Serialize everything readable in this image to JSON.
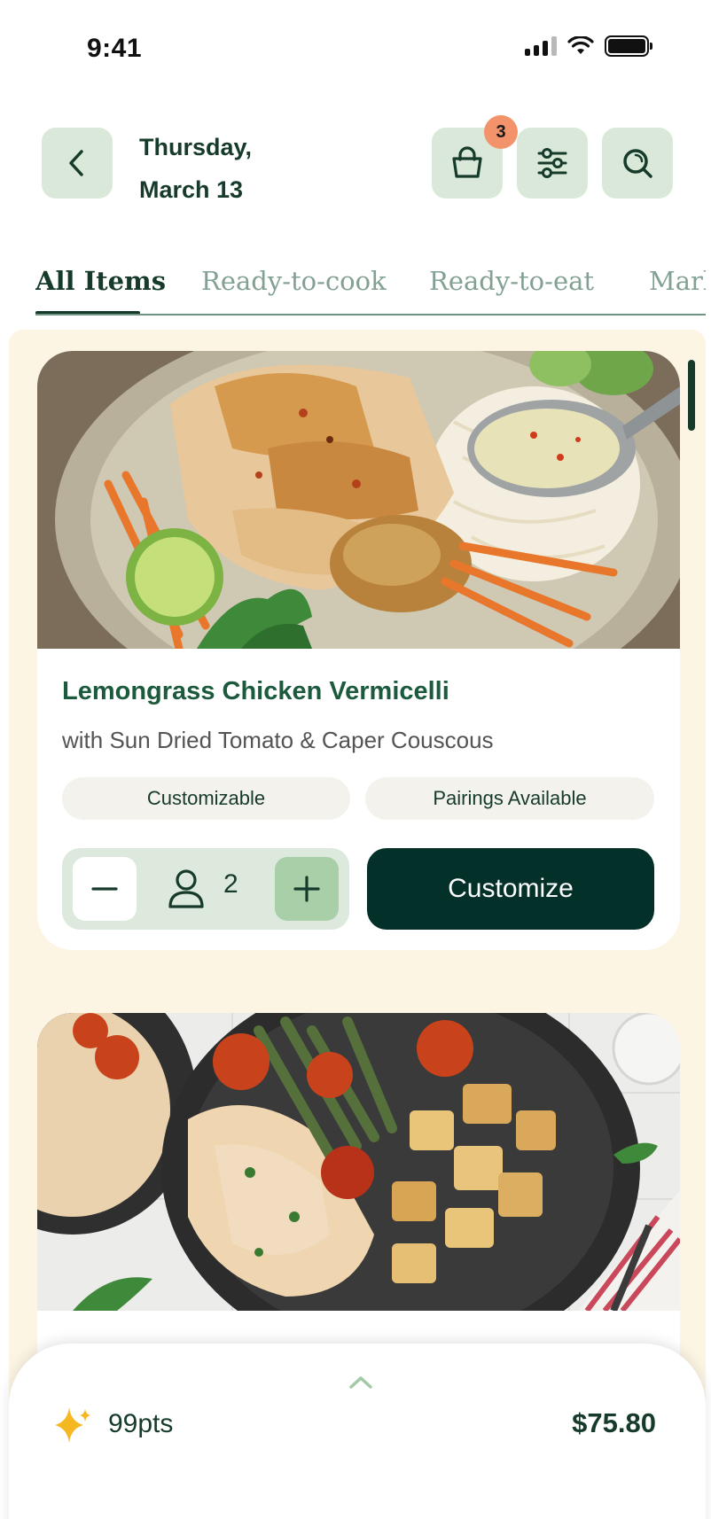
{
  "status_bar": {
    "time": "9:41"
  },
  "header": {
    "date_line1": "Thursday,",
    "date_line2": "March 13",
    "cart_count": "3"
  },
  "tabs": [
    {
      "label": "All Items",
      "active": true
    },
    {
      "label": "Ready-to-cook",
      "active": false
    },
    {
      "label": "Ready-to-eat",
      "active": false
    },
    {
      "label": "Market",
      "active": false
    }
  ],
  "meals": [
    {
      "title": "Lemongrass Chicken Vermicelli",
      "subtitle": "with Sun Dried Tomato & Caper Couscous",
      "tags": [
        "Customizable",
        "Pairings Available"
      ],
      "servings": "2",
      "action_label": "Customize"
    },
    {
      "title": "",
      "subtitle": ""
    }
  ],
  "footer": {
    "points": "99pts",
    "total": "$75.80"
  },
  "colors": {
    "brand_dark": "#04302a",
    "brand_green": "#1c5a3d",
    "mint": "#d9e8d8",
    "cream": "#fdf5e4",
    "badge": "#f2936b"
  },
  "icons": [
    "back-icon",
    "basket-icon",
    "filter-icon",
    "search-icon",
    "minus-icon",
    "person-icon",
    "plus-icon",
    "chevron-up-icon",
    "sparkle-icon"
  ]
}
